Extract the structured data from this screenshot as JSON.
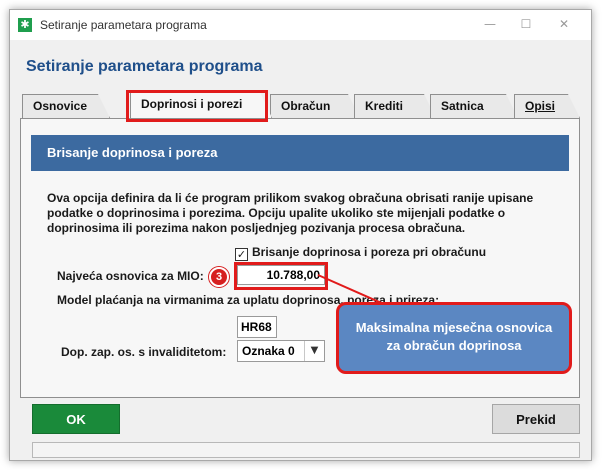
{
  "window": {
    "title": "Setiranje parametara programa",
    "heading": "Setiranje parametara programa",
    "icon": "asterisk-app-icon",
    "controls": [
      "—",
      "☐",
      "✕"
    ]
  },
  "tabs": [
    {
      "label": "Osnovice",
      "active": false
    },
    {
      "label": "Doprinosi i porezi",
      "active": true
    },
    {
      "label": "Obračun",
      "active": false
    },
    {
      "label": "Krediti",
      "active": false
    },
    {
      "label": "Satnica",
      "active": false
    },
    {
      "label": "Opisi",
      "active": false
    }
  ],
  "panel": {
    "section_title": "Brisanje doprinosa i poreza",
    "description": "Ova opcija definira da li će program prilikom svakog obračuna obrisati ranije upisane podatke o doprinosima i porezima. Opciju upalite ukoliko ste mijenjali podatke o doprinosima ili porezima nakon posljednjeg pozivanja procesa obračuna.",
    "checkbox_label": "Brisanje doprinosa i poreza pri obračunu",
    "checkbox_checked": true,
    "mio_label": "Najveća osnovica za MIO:",
    "mio_value": "10.788,00",
    "step_number": "3",
    "payment_model_label": "Model plaćanja na virmanima za uplatu doprinosa, poreza i prireza:",
    "payment_model_code": "HR68",
    "disability_label": "Dop. zap. os. s invaliditetom:",
    "disability_value": "Oznaka 0"
  },
  "callout": {
    "line1": "Maksimalna mjesečna osnovica",
    "line2": "za obračun doprinosa"
  },
  "buttons": {
    "ok": "OK",
    "cancel": "Prekid"
  },
  "colors": {
    "heading": "#1f4f8a",
    "section_header": "#3c6aa0",
    "highlight": "#e11b1b",
    "ok_button": "#1a8a3a",
    "callout": "#5b87c2"
  }
}
